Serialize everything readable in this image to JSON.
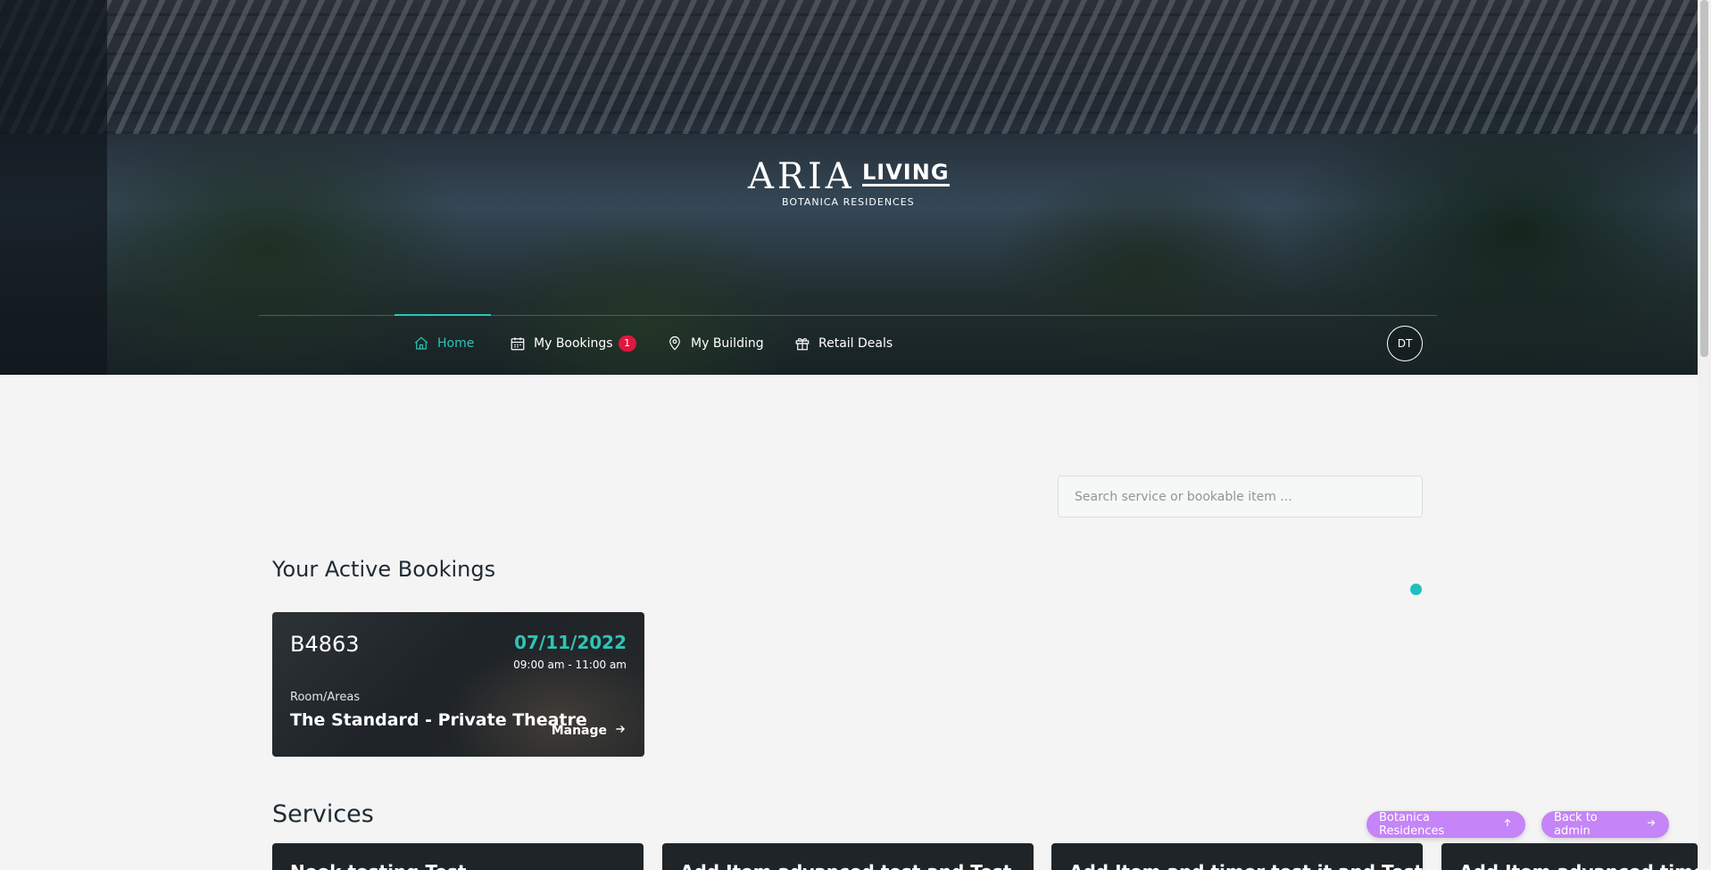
{
  "brand": {
    "name_part1": "ARIA",
    "name_part2": "LIVING",
    "subtitle": "BOTANICA RESIDENCES"
  },
  "nav": {
    "items": [
      {
        "label": "Home",
        "icon": "home-icon",
        "active": true
      },
      {
        "label": "My Bookings",
        "icon": "calendar-icon",
        "badge": "1"
      },
      {
        "label": "My Building",
        "icon": "location-pin-icon"
      },
      {
        "label": "Retail Deals",
        "icon": "gift-icon"
      }
    ],
    "avatar_initials": "DT"
  },
  "search": {
    "placeholder": "Search service or bookable item ..."
  },
  "active_bookings": {
    "heading": "Your Active Bookings",
    "items": [
      {
        "code": "B4863",
        "date": "07/11/2022",
        "time": "09:00 am - 11:00 am",
        "type": "Room/Areas",
        "name": "The Standard - Private Theatre",
        "action": "Manage"
      }
    ]
  },
  "services": {
    "heading": "Services",
    "cards": [
      {
        "title": "Nook testing Test"
      },
      {
        "title": "Add Item advanced test and Test"
      },
      {
        "title": "Add Item and timer test it and Test"
      },
      {
        "title": "Add Item advanced timer test"
      }
    ]
  },
  "floating": {
    "botanica_label": "Botanica Residences",
    "admin_label": "Back to admin"
  },
  "colors": {
    "accent": "#2cc5b5",
    "badge": "#e0173f",
    "pill": "#c584f7",
    "card_bg": "#1f2428"
  }
}
